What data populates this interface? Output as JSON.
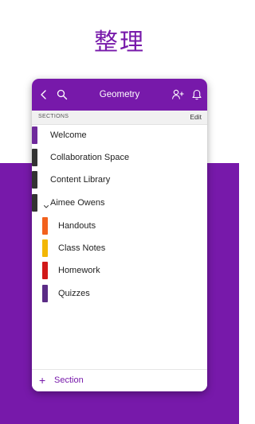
{
  "headline": "整理",
  "titlebar": {
    "title": "Geometry",
    "back_icon": "chevron-left-icon",
    "search_icon": "search-icon",
    "share_icon": "add-person-icon",
    "notifications_icon": "bell-icon"
  },
  "section_bar": {
    "label": "SECTIONS",
    "edit_label": "Edit"
  },
  "sections": [
    {
      "label": "Welcome",
      "tab_color": "#6f2a9c",
      "level": 0,
      "selected": true
    },
    {
      "label": "Collaboration Space",
      "tab_color": "#333333",
      "level": 0
    },
    {
      "label": "Content Library",
      "tab_color": "#333333",
      "level": 0
    },
    {
      "label": "Aimee Owens",
      "tab_color": "#333333",
      "level": 0,
      "expanded": true
    },
    {
      "label": "Handouts",
      "tab_color": "#f2611d",
      "level": 1
    },
    {
      "label": "Class Notes",
      "tab_color": "#f2b705",
      "level": 1
    },
    {
      "label": "Homework",
      "tab_color": "#d11919",
      "level": 1
    },
    {
      "label": "Quizzes",
      "tab_color": "#5b2c86",
      "level": 1
    }
  ],
  "bottom_bar": {
    "plus": "+",
    "add_label": "Section"
  },
  "colors": {
    "brand": "#7719aa",
    "background_bottom": "#7719aa"
  }
}
